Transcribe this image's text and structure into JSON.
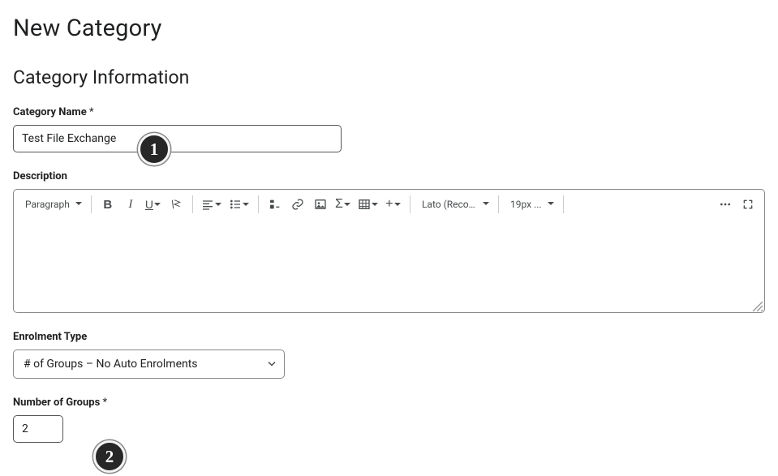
{
  "page": {
    "title": "New Category",
    "section_title": "Category Information"
  },
  "labels": {
    "category_name": "Category Name",
    "required_mark": "*",
    "description": "Description",
    "enrolment_type": "Enrolment Type",
    "number_of_groups": "Number of Groups"
  },
  "values": {
    "category_name": "Test File Exchange",
    "enrolment_type": "# of Groups – No Auto Enrolments",
    "number_of_groups": "2"
  },
  "editor": {
    "block_format": "Paragraph",
    "font": "Lato (Recom…",
    "font_size": "19px ...",
    "content": ""
  },
  "badges": {
    "one": "1",
    "two": "2"
  }
}
